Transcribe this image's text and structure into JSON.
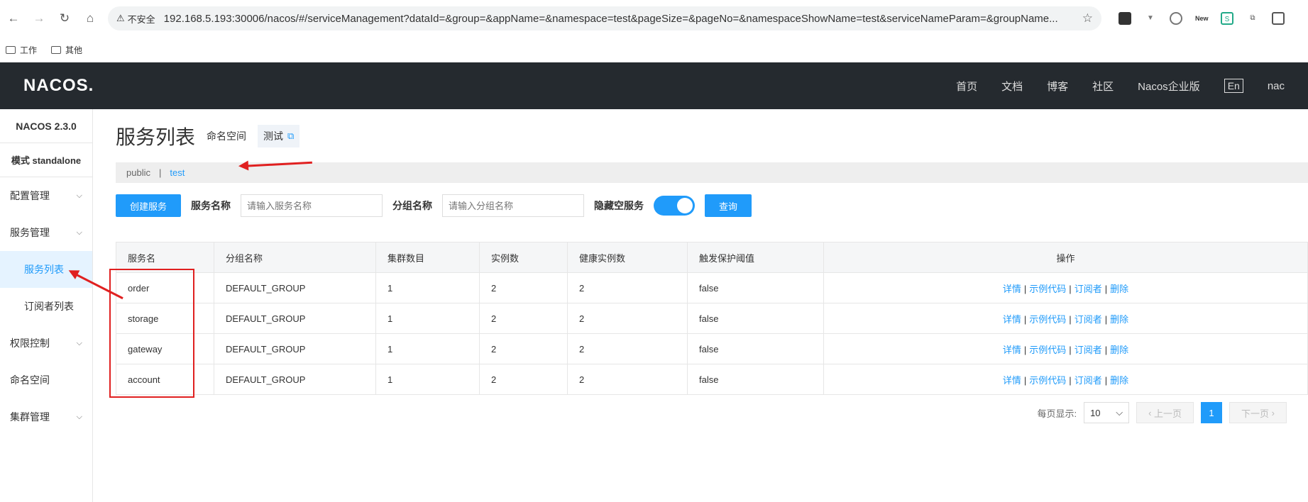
{
  "browser": {
    "url": "192.168.5.193:30006/nacos/#/serviceManagement?dataId=&group=&appName=&namespace=test&pageSize=&pageNo=&namespaceShowName=test&serviceNameParam=&groupName...",
    "insecure": "不安全",
    "new_badge": "New"
  },
  "bookmarks": [
    "工作",
    "其他"
  ],
  "topnav": {
    "logo": "NACOS.",
    "items": [
      "首页",
      "文档",
      "博客",
      "社区",
      "Nacos企业版"
    ],
    "lang": "En",
    "user": "nac"
  },
  "sidebar": {
    "version": "NACOS 2.3.0",
    "mode": "模式 standalone",
    "items": [
      {
        "label": "配置管理",
        "chev": "⌵"
      },
      {
        "label": "服务管理",
        "chev": "⌵"
      },
      {
        "label": "服务列表",
        "sub": true,
        "active": true
      },
      {
        "label": "订阅者列表",
        "sub": true
      },
      {
        "label": "权限控制",
        "chev": "⌵"
      },
      {
        "label": "命名空间"
      },
      {
        "label": "集群管理",
        "chev": "⌵"
      }
    ]
  },
  "page": {
    "title": "服务列表",
    "ns_label": "命名空间",
    "ns_value": "测试"
  },
  "nsbar": {
    "public": "public",
    "sep": "|",
    "test": "test"
  },
  "filter": {
    "create": "创建服务",
    "service_label": "服务名称",
    "service_ph": "请输入服务名称",
    "group_label": "分组名称",
    "group_ph": "请输入分组名称",
    "hide_label": "隐藏空服务",
    "query": "查询"
  },
  "table": {
    "headers": [
      "服务名",
      "分组名称",
      "集群数目",
      "实例数",
      "健康实例数",
      "触发保护阈值",
      "操作"
    ],
    "rows": [
      [
        "order",
        "DEFAULT_GROUP",
        "1",
        "2",
        "2",
        "false"
      ],
      [
        "storage",
        "DEFAULT_GROUP",
        "1",
        "2",
        "2",
        "false"
      ],
      [
        "gateway",
        "DEFAULT_GROUP",
        "1",
        "2",
        "2",
        "false"
      ],
      [
        "account",
        "DEFAULT_GROUP",
        "1",
        "2",
        "2",
        "false"
      ]
    ],
    "ops": [
      "详情",
      "示例代码",
      "订阅者",
      "删除"
    ]
  },
  "pager": {
    "per_page": "每页显示:",
    "size": "10",
    "prev": "上一页",
    "page": "1",
    "next": "下一页"
  }
}
